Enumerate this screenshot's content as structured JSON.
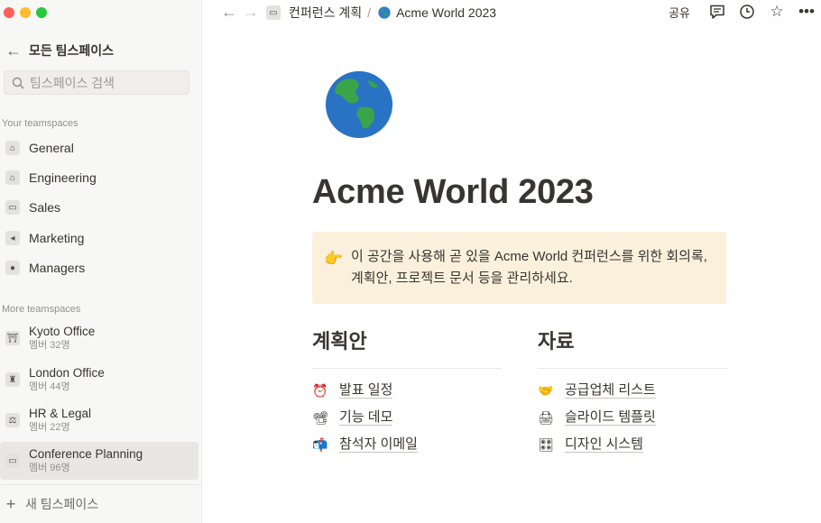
{
  "sidebar": {
    "back_label": "모든 팀스페이스",
    "search_placeholder": "팀스페이스 검색",
    "your_heading": "Your teamspaces",
    "your_items": [
      {
        "label": "General",
        "icon": "home-icon"
      },
      {
        "label": "Engineering",
        "icon": "home-icon"
      },
      {
        "label": "Sales",
        "icon": "money-icon"
      },
      {
        "label": "Marketing",
        "icon": "megaphone-icon"
      },
      {
        "label": "Managers",
        "icon": "people-icon"
      }
    ],
    "more_heading": "More teamspaces",
    "more_items": [
      {
        "label": "Kyoto Office",
        "sub": "멤버 32명",
        "icon": "torii-icon"
      },
      {
        "label": "London Office",
        "sub": "멤버 44명",
        "icon": "castle-icon"
      },
      {
        "label": "HR & Legal",
        "sub": "멤버 22명",
        "icon": "scales-icon"
      },
      {
        "label": "Conference Planning",
        "sub": "멤버 96명",
        "icon": "ticket-icon"
      }
    ],
    "new_label": "새 팀스페이스"
  },
  "topbar": {
    "crumb_parent": "컨퍼런스 계획",
    "crumb_sep": "/",
    "crumb_current": "Acme World 2023",
    "share_label": "공유"
  },
  "page": {
    "title": "Acme World 2023",
    "callout_emoji": "👉",
    "callout_text": "이 공간을 사용해 곧 있을 Acme World 컨퍼런스를 위한 회의록, 계획안, 프로젝트 문서 등을 관리하세요.",
    "columns": [
      {
        "heading": "계획안",
        "links": [
          {
            "emoji": "⏰",
            "label": "발표 일정"
          },
          {
            "emoji": "📽",
            "label": "기능 데모"
          },
          {
            "emoji": "📬",
            "label": "참석자 이메일"
          }
        ]
      },
      {
        "heading": "자료",
        "links": [
          {
            "emoji": "🤝",
            "label": "공급업체 리스트"
          },
          {
            "emoji": "🖨",
            "label": "슬라이드 템플릿"
          },
          {
            "emoji": "🎛",
            "label": "디자인 시스템"
          }
        ]
      }
    ]
  },
  "colors": {
    "sidebar_bg": "#f7f7f5",
    "callout_bg": "#fbf0dc",
    "text": "#37352f",
    "muted": "#91918e"
  }
}
